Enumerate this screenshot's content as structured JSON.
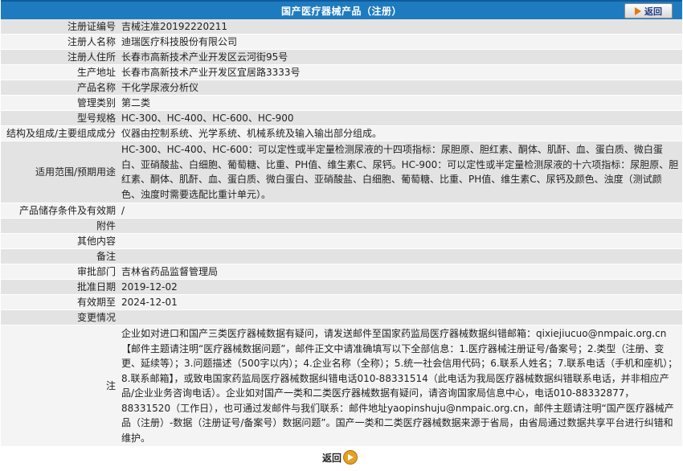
{
  "header": {
    "title": "国产医疗器械产品（注册）",
    "back_label": "返回"
  },
  "rows": [
    {
      "label": "注册证编号",
      "value": "吉械注准20192220211"
    },
    {
      "label": "注册人名称",
      "value": "迪瑞医疗科技股份有限公司"
    },
    {
      "label": "注册人住所",
      "value": "长春市高新技术产业开发区云河街95号"
    },
    {
      "label": "生产地址",
      "value": "长春市高新技术产业开发区宜居路3333号"
    },
    {
      "label": "产品名称",
      "value": "干化学尿液分析仪"
    },
    {
      "label": "管理类别",
      "value": "第二类"
    },
    {
      "label": "型号规格",
      "value": "HC-300、HC-400、HC-600、HC-900"
    },
    {
      "label": "结构及组成/主要组成成分",
      "value": "仪器由控制系统、光学系统、机械系统及输入输出部分组成。"
    },
    {
      "label": "适用范围/预期用途",
      "value": "HC-300、HC-400、HC-600：可以定性或半定量检测尿液的十四项指标：尿胆原、胆红素、酮体、肌酐、血、蛋白质、微白蛋白、亚硝酸盐、白细胞、葡萄糖、比重、PH值、维生素C、尿钙。HC-900：可以定性或半定量检测尿液的十六项指标：尿胆原、胆红素、酮体、肌酐、血、蛋白质、微白蛋白、亚硝酸盐、白细胞、葡萄糖、比重、PH值、维生素C、尿钙及颜色、浊度（测试颜色、浊度时需要选配比重计单元）。"
    },
    {
      "label": "产品储存条件及有效期",
      "value": "/"
    },
    {
      "label": "附件",
      "value": ""
    },
    {
      "label": "其他内容",
      "value": ""
    },
    {
      "label": "备注",
      "value": ""
    },
    {
      "label": "审批部门",
      "value": "吉林省药品监督管理局"
    },
    {
      "label": "批准日期",
      "value": "2019-12-02"
    },
    {
      "label": "有效期至",
      "value": "2024-12-01"
    },
    {
      "label": "变更情况",
      "value": ""
    },
    {
      "label": "注",
      "value": "企业如对进口和国产三类医疗器械数据有疑问，请发送邮件至国家药监局医疗器械数据纠错邮箱：qixiejiucuo@nmpaic.org.cn【邮件主题请注明“医疗器械数据问题”，邮件正文中请准确填写以下全部信息：1.医疗器械注册证号/备案号；2.类型（注册、变更、延续等）；3.问题描述（500字以内）；4.企业名称（全称）；5.统一社会信用代码；6.联系人姓名；7.联系电话（手机和座机）；8.联系邮箱】，或致电国家药监局医疗器械数据纠错电话010-88331514（此电话为我局医疗器械数据纠错联系电话，并非相应产品/企业业务咨询电话）。企业如对国产一类和二类医疗器械数据有疑问，请咨询国家局信息中心，电话010-88332877，88331520（工作日），也可通过发邮件与我们联系：邮件地址yaopinshuju@nmpaic.org.cn，邮件主题请注明“国产医疗器械产品（注册）-数据（注册证号/备案号）数据问题”。国产一类和二类医疗器械数据来源于省局，由省局通过数据共享平台进行纠错和维护。"
    }
  ],
  "footer": {
    "back_label": "返回"
  }
}
